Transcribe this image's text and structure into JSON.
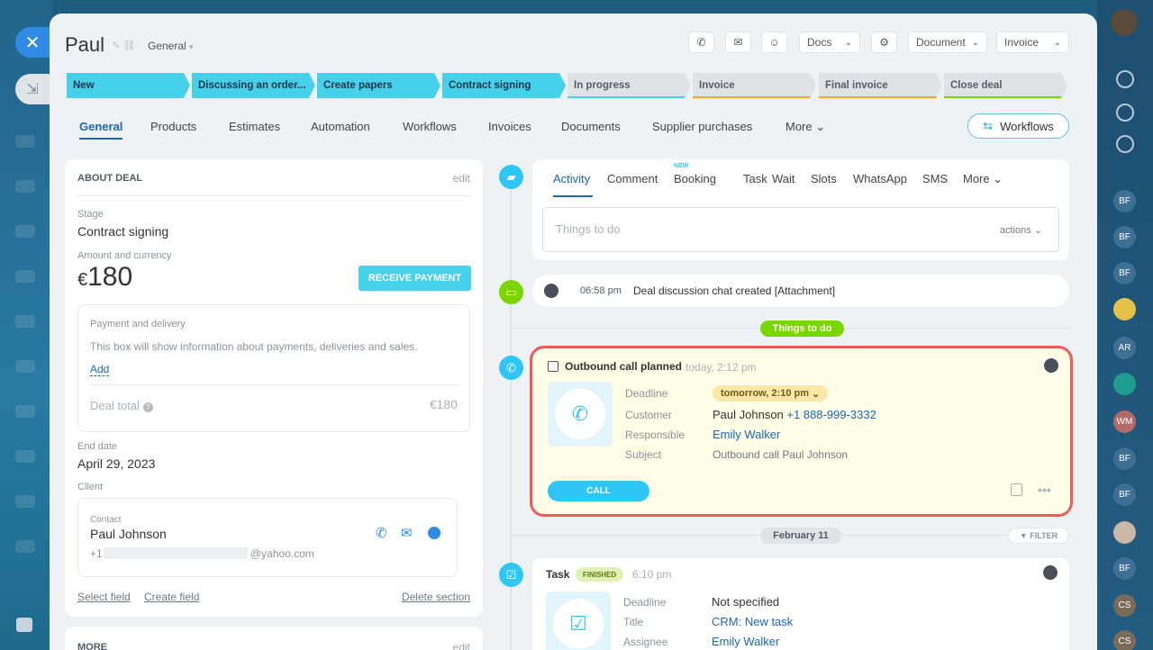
{
  "deal": {
    "title": "Paul",
    "category": "General"
  },
  "toolbar": {
    "docs": "Docs",
    "document": "Document",
    "invoice": "Invoice"
  },
  "stages": [
    {
      "label": "New",
      "state": "done"
    },
    {
      "label": "Discussing an order...",
      "state": "done"
    },
    {
      "label": "Create papers",
      "state": "done"
    },
    {
      "label": "Contract signing",
      "state": "done"
    },
    {
      "label": "In progress",
      "state": "todo",
      "color": "#47d0ea"
    },
    {
      "label": "Invoice",
      "state": "todo",
      "color": "#f5a623"
    },
    {
      "label": "Final invoice",
      "state": "todo",
      "color": "#f5a623"
    },
    {
      "label": "Close deal",
      "state": "todo",
      "color": "#7bd500"
    }
  ],
  "tabs": [
    "General",
    "Products",
    "Estimates",
    "Automation",
    "Workflows",
    "Invoices",
    "Documents",
    "Supplier purchases",
    "More"
  ],
  "workflows_button": "Workflows",
  "about": {
    "heading": "ABOUT DEAL",
    "edit": "edit",
    "stage_label": "Stage",
    "stage_value": "Contract signing",
    "amount_label": "Amount and currency",
    "currency": "€",
    "amount": "180",
    "receive_payment": "RECEIVE PAYMENT",
    "payment_title": "Payment and delivery",
    "payment_info": "This box will show information about payments, deliveries and sales.",
    "add": "Add",
    "deal_total_label": "Deal total",
    "deal_total": "€180",
    "end_date_label": "End date",
    "end_date": "April 29, 2023",
    "client_label": "Client",
    "contact_label": "Contact",
    "contact_name": "Paul Johnson",
    "phone_prefix": "+1",
    "email_suffix": "@yahoo.com",
    "select_field": "Select field",
    "create_field": "Create field",
    "delete_section": "Delete section",
    "more_heading": "MORE",
    "more_edit": "edit"
  },
  "activity_tabs": [
    "Activity",
    "Comment",
    "Booking",
    "Task",
    "Wait",
    "Slots",
    "WhatsApp",
    "SMS",
    "More"
  ],
  "activity_new_badge": "NEW",
  "things_placeholder": "Things to do",
  "actions_label": "actions",
  "chat_event": {
    "time": "06:58 pm",
    "text": "Deal discussion chat created [Attachment]"
  },
  "things_to_do_chip": "Things to do",
  "call": {
    "title": "Outbound call planned",
    "time": "today, 2:12 pm",
    "deadline_label": "Deadline",
    "deadline": "tomorrow, 2:10 pm",
    "customer_label": "Customer",
    "customer": "Paul Johnson",
    "customer_phone": "+1 888-999-3332",
    "responsible_label": "Responsible",
    "responsible": "Emily Walker",
    "subject_label": "Subject",
    "subject": "Outbound call Paul Johnson",
    "call_button": "CALL"
  },
  "date_chip": "February 11",
  "filter": "FILTER",
  "task": {
    "title": "Task",
    "status": "FINISHED",
    "time": "6:10 pm",
    "deadline_label": "Deadline",
    "deadline": "Not specified",
    "title_label": "Title",
    "title_value": "CRM: New task",
    "assignee_label": "Assignee",
    "assignee": "Emily Walker"
  },
  "right_avatars": [
    "BF",
    "BF",
    "BF",
    "AR",
    "WM",
    "BF",
    "BF",
    "BF",
    "CS",
    "CS"
  ],
  "colors": {
    "accent": "#2066b0",
    "stage_done": "#47d0ea",
    "green": "#7bd500",
    "highlight": "#ef5b5b"
  }
}
